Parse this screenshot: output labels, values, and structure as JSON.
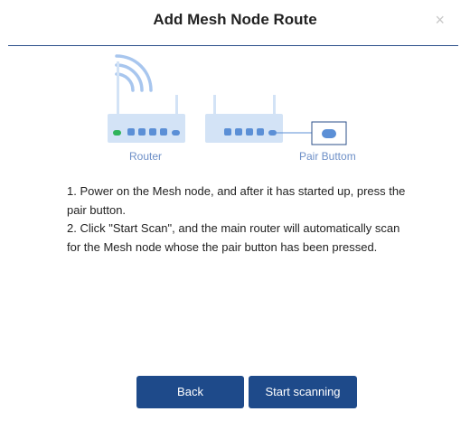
{
  "dialog": {
    "title": "Add Mesh Node Route",
    "close_symbol": "×"
  },
  "illustration": {
    "router_label": "Router",
    "pair_label": "Pair Buttom",
    "colors": {
      "device": "#d3e3f6",
      "port": "#5b8fd6",
      "led_green": "#2fb45a",
      "wifi": "#a8c6ee",
      "label": "#6d8fc7"
    }
  },
  "instructions": [
    "1. Power on the Mesh node, and after it has started up, press the pair button.",
    "2. Click \"Start Scan\", and the main router will automatically scan for the Mesh node whose the pair button has been pressed."
  ],
  "buttons": {
    "back": "Back",
    "start": "Start scanning"
  },
  "colors": {
    "primary": "#1e4a8a",
    "divider": "#2b4f8a"
  }
}
